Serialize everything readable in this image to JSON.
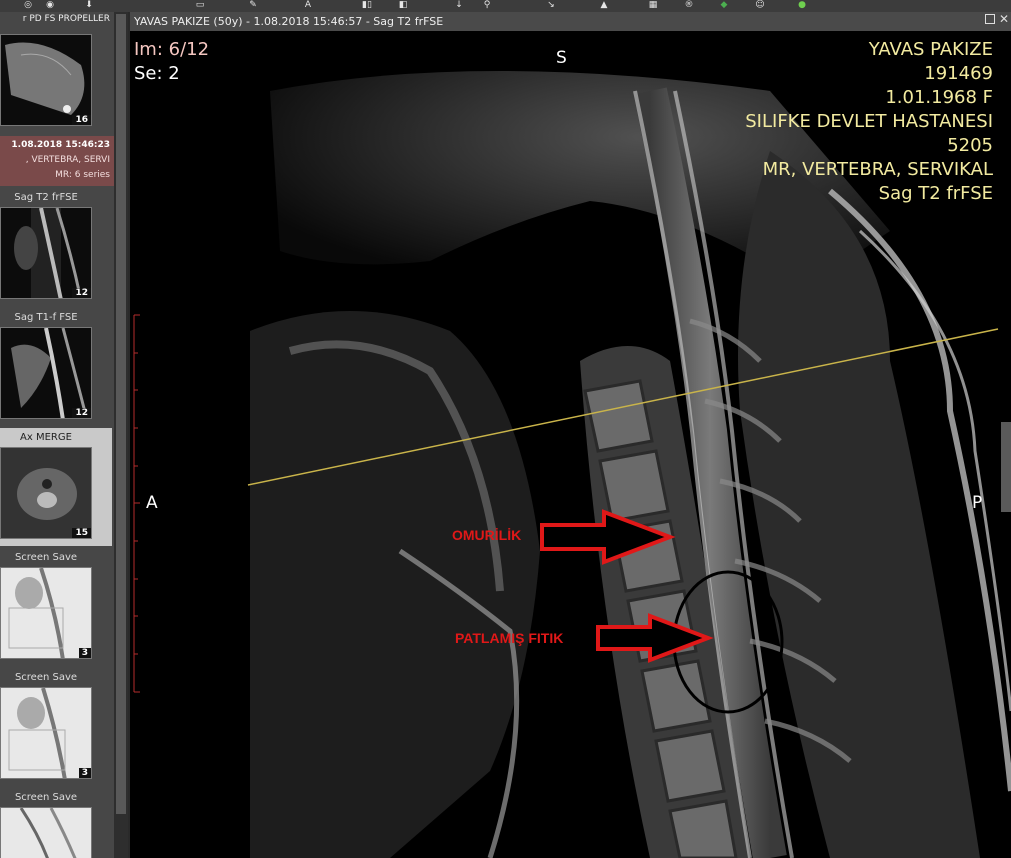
{
  "top_series_label": "r PD FS PROPELLER",
  "study": {
    "datetime": "1.08.2018 15:46:23",
    "description": ", VERTEBRA, SERVI",
    "modality_series": "MR: 6 series"
  },
  "series": [
    {
      "label": "",
      "count": "16"
    },
    {
      "label": "Sag T2 frFSE",
      "count": "12"
    },
    {
      "label": "Sag T1-f FSE",
      "count": "12"
    },
    {
      "label": "Ax MERGE",
      "count": "15"
    },
    {
      "label": "Screen Save",
      "count": "3"
    },
    {
      "label": "Screen Save",
      "count": "3"
    },
    {
      "label": "Screen Save",
      "count": ""
    }
  ],
  "viewer": {
    "window_title": "YAVAS PAKIZE (50y) - 1.08.2018 15:46:57 - Sag T2 frFSE",
    "image_index": "Im: 6/12",
    "series_index": "Se: 2",
    "patient_name": "YAVAS PAKIZE",
    "patient_id": "191469",
    "birth_sex": "1.01.1968 F",
    "institution": "SILIFKE DEVLET HASTANESI",
    "study_code": "5205",
    "study_desc": "MR, VERTEBRA, SERVIKAL",
    "series_desc": "Sag T2 frFSE",
    "orient_top": "S",
    "orient_left": "A",
    "orient_right": "P"
  },
  "annotations": {
    "label1": "OMURİLİK",
    "label2": "PATLAMIŞ FITIK",
    "arrow_color": "#e01818",
    "circle_color": "#000000",
    "reference_line_color": "#c9b44a"
  }
}
